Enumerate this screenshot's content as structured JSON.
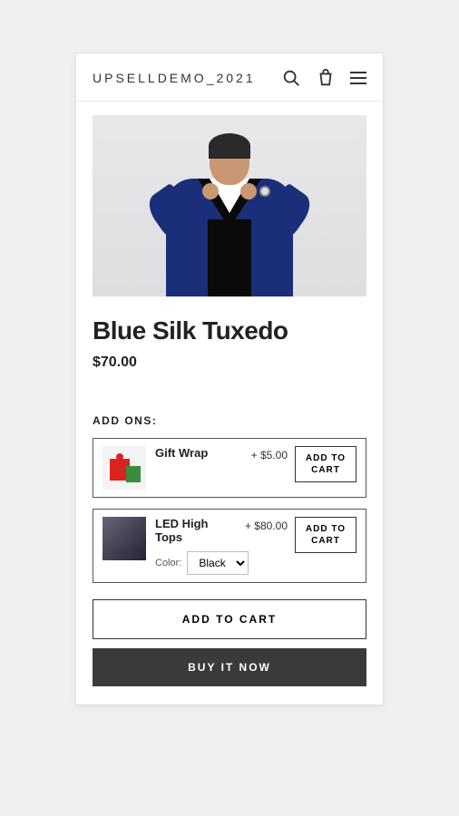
{
  "header": {
    "site_title": "UPSELLDEMO_2021"
  },
  "product": {
    "title": "Blue Silk Tuxedo",
    "price": "$70.00"
  },
  "addons": {
    "section_label": "ADD ONS:",
    "items": [
      {
        "name": "Gift Wrap",
        "price": "+ $5.00",
        "button_label": "ADD TO CART"
      },
      {
        "name": "LED High Tops",
        "price": "+ $80.00",
        "button_label": "ADD TO CART",
        "color_label": "Color:",
        "color_value": "Black"
      }
    ]
  },
  "actions": {
    "add_to_cart": "ADD TO CART",
    "buy_it_now": "BUY IT NOW"
  }
}
